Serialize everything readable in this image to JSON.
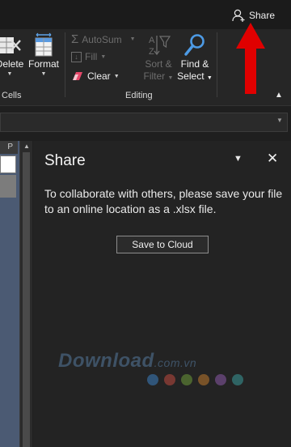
{
  "titlebar": {
    "share_label": "Share"
  },
  "ribbon": {
    "delete_label": "Delete",
    "format_label": "Format",
    "autosum_label": "AutoSum",
    "fill_label": "Fill",
    "clear_label": "Clear",
    "sort_filter_line1": "Sort &",
    "sort_filter_line2": "Filter",
    "find_select_line1": "Find &",
    "find_select_line2": "Select",
    "group_cells": "Cells",
    "group_editing": "Editing"
  },
  "sheet": {
    "column_header": "P"
  },
  "share_pane": {
    "title": "Share",
    "message": "To collaborate with others, please save your file to an online location as a .xlsx file.",
    "save_button": "Save to Cloud"
  },
  "watermark": {
    "text": "Download",
    "suffix": ".com.vn",
    "dot_colors": [
      "#3d7fc1",
      "#c04b3f",
      "#6d9a3a",
      "#c07a2e",
      "#8a5aa8",
      "#3b9a9a"
    ]
  },
  "colors": {
    "annotation_arrow": "#e00000",
    "pane_background": "#232323",
    "ribbon_background": "#262626"
  }
}
